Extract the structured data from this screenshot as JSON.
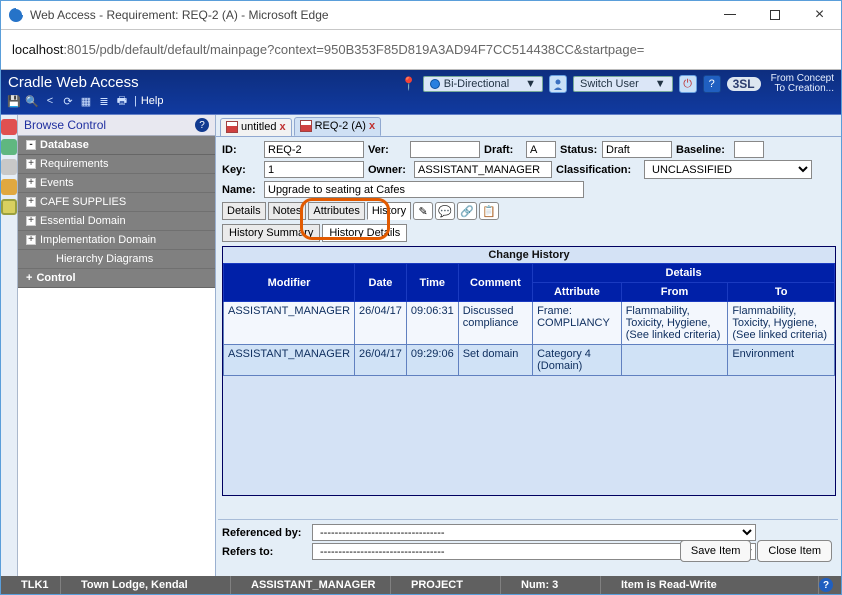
{
  "window": {
    "title": "Web Access - Requirement: REQ-2 (A) - Microsoft Edge",
    "url_host": "localhost",
    "url_path": ":8015/pdb/default/default/mainpage?context=950B353F85D819A3AD94F7CC514438CC&startpage="
  },
  "appheader": {
    "title": "Cradle Web Access",
    "help_label": "Help",
    "direction_label": "Bi-Directional",
    "switch_user_label": "Switch User",
    "logo_tag": "3SL",
    "concept_line1": "From Concept",
    "concept_line2": "To Creation..."
  },
  "sidebar": {
    "panel_title": "Browse Control",
    "groups": [
      {
        "label": "Database",
        "expand": "-"
      },
      {
        "label": "Requirements",
        "icon": "+",
        "sub": true
      },
      {
        "label": "Events",
        "icon": "+",
        "sub": true
      },
      {
        "label": "CAFE SUPPLIES",
        "icon": "+",
        "sub": true
      },
      {
        "label": "Essential Domain",
        "icon": "+",
        "sub": true
      },
      {
        "label": "Implementation Domain",
        "icon": "+",
        "sub": true
      },
      {
        "label": "Hierarchy Diagrams",
        "icon": "",
        "sub": true
      },
      {
        "label": "Control",
        "expand": "+"
      }
    ]
  },
  "tabs": {
    "untitled": "untitled",
    "req": "REQ-2 (A)"
  },
  "fields": {
    "id_lbl": "ID:",
    "id_val": "REQ-2",
    "ver_lbl": "Ver:",
    "ver_val": "",
    "draft_lbl": "Draft:",
    "draft_val": "A",
    "status_lbl": "Status:",
    "status_val": "Draft",
    "baseline_lbl": "Baseline:",
    "baseline_val": "",
    "key_lbl": "Key:",
    "key_val": "1",
    "owner_lbl": "Owner:",
    "owner_val": "ASSISTANT_MANAGER",
    "class_lbl": "Classification:",
    "class_val": "UNCLASSIFIED",
    "name_lbl": "Name:",
    "name_val": "Upgrade to seating at Cafes"
  },
  "detailtabs": {
    "details": "Details",
    "notes": "Notes",
    "attributes": "Attributes",
    "history": "History"
  },
  "subtabs": {
    "summary": "History Summary",
    "details": "History Details"
  },
  "history": {
    "title": "Change History",
    "cols": {
      "modifier": "Modifier",
      "date": "Date",
      "time": "Time",
      "comment": "Comment",
      "details": "Details",
      "attribute": "Attribute",
      "from": "From",
      "to": "To"
    },
    "rows": [
      {
        "modifier": "ASSISTANT_MANAGER",
        "date": "26/04/17",
        "time": "09:06:31",
        "comment": "Discussed compliance",
        "attribute": "Frame: COMPLIANCY",
        "from": "Flammability, Toxicity, Hygiene, (See linked criteria)",
        "to": "Flammability, Toxicity, Hygiene, (See linked criteria)"
      },
      {
        "modifier": "ASSISTANT_MANAGER",
        "date": "26/04/17",
        "time": "09:29:06",
        "comment": "Set domain",
        "attribute": "Category 4 (Domain)",
        "from": "",
        "to": "Environment"
      }
    ]
  },
  "refs": {
    "refby_lbl": "Referenced by:",
    "refto_lbl": "Refers to:",
    "placeholder": "----------------------------------"
  },
  "buttons": {
    "save": "Save Item",
    "close": "Close Item"
  },
  "status": {
    "c1": "TLK1",
    "c2": "Town Lodge, Kendal",
    "c3": "ASSISTANT_MANAGER",
    "c4": "PROJECT",
    "c5": "Num: 3",
    "c6": "Item is Read-Write"
  }
}
